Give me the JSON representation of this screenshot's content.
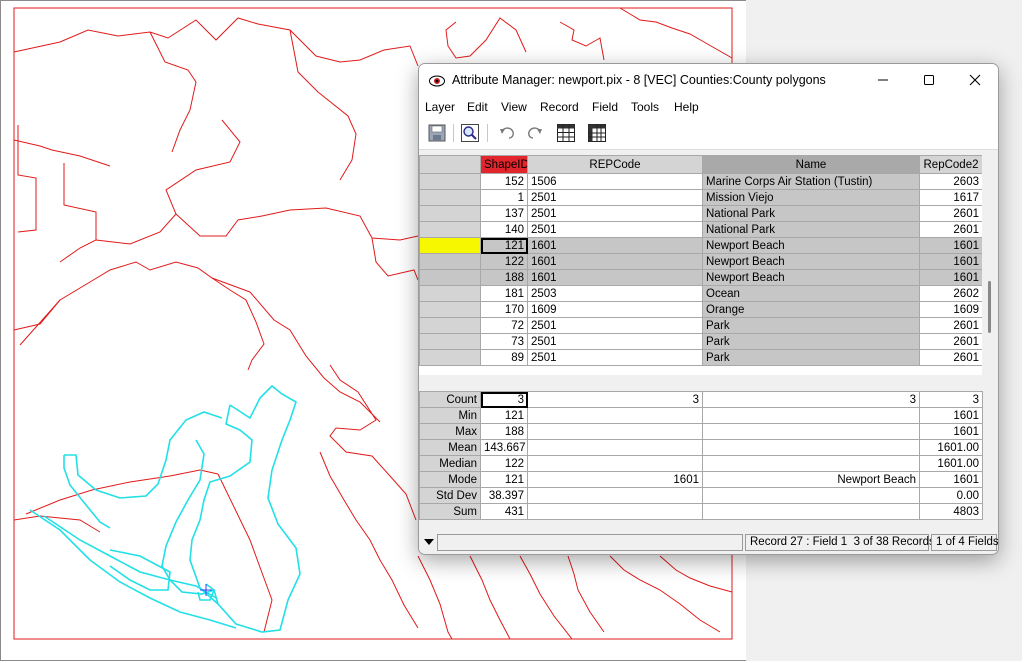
{
  "window": {
    "title": "Attribute Manager: newport.pix - 8 [VEC] Counties:County polygons",
    "minimize_icon": "minimize-icon",
    "maximize_icon": "maximize-icon",
    "close_icon": "close-icon"
  },
  "menu": [
    "Layer",
    "Edit",
    "View",
    "Record",
    "Field",
    "Tools",
    "Help"
  ],
  "toolbar": [
    "save-icon",
    "zoom-to-record-icon",
    "undo-icon",
    "redo-icon",
    "table-icon",
    "grid-table-icon"
  ],
  "table": {
    "columns": [
      "ShapeID",
      "REPCode",
      "Name",
      "RepCode2"
    ],
    "rows": [
      {
        "shapeid": "152",
        "repcode": "1506",
        "name": "Marine Corps Air Station (Tustin)",
        "repcode2": "2603",
        "selected": false
      },
      {
        "shapeid": "1",
        "repcode": "2501",
        "name": "Mission Viejo",
        "repcode2": "1617",
        "selected": false
      },
      {
        "shapeid": "137",
        "repcode": "2501",
        "name": "National Park",
        "repcode2": "2601",
        "selected": false
      },
      {
        "shapeid": "140",
        "repcode": "2501",
        "name": "National Park",
        "repcode2": "2601",
        "selected": false
      },
      {
        "shapeid": "121",
        "repcode": "1601",
        "name": "Newport Beach",
        "repcode2": "1601",
        "selected": true
      },
      {
        "shapeid": "122",
        "repcode": "1601",
        "name": "Newport Beach",
        "repcode2": "1601",
        "selected": true
      },
      {
        "shapeid": "188",
        "repcode": "1601",
        "name": "Newport Beach",
        "repcode2": "1601",
        "selected": true
      },
      {
        "shapeid": "181",
        "repcode": "2503",
        "name": "Ocean",
        "repcode2": "2602",
        "selected": false
      },
      {
        "shapeid": "170",
        "repcode": "1609",
        "name": "Orange",
        "repcode2": "1609",
        "selected": false
      },
      {
        "shapeid": "72",
        "repcode": "2501",
        "name": "Park",
        "repcode2": "2601",
        "selected": false
      },
      {
        "shapeid": "73",
        "repcode": "2501",
        "name": "Park",
        "repcode2": "2601",
        "selected": false
      },
      {
        "shapeid": "89",
        "repcode": "2501",
        "name": "Park",
        "repcode2": "2601",
        "selected": false
      }
    ]
  },
  "stats": [
    {
      "label": "Count",
      "shapeid": "3",
      "repcode": "3",
      "name": "3",
      "repcode2": "3"
    },
    {
      "label": "Min",
      "shapeid": "121",
      "repcode": "",
      "name": "",
      "repcode2": "1601"
    },
    {
      "label": "Max",
      "shapeid": "188",
      "repcode": "",
      "name": "",
      "repcode2": "1601"
    },
    {
      "label": "Mean",
      "shapeid": "143.667",
      "repcode": "",
      "name": "",
      "repcode2": "1601.00"
    },
    {
      "label": "Median",
      "shapeid": "122",
      "repcode": "",
      "name": "",
      "repcode2": "1601.00"
    },
    {
      "label": "Mode",
      "shapeid": "121",
      "repcode": "1601",
      "name": "Newport Beach",
      "repcode2": "1601"
    },
    {
      "label": "Std Dev",
      "shapeid": "38.397",
      "repcode": "",
      "name": "",
      "repcode2": "0.00"
    },
    {
      "label": "Sum",
      "shapeid": "431",
      "repcode": "",
      "name": "",
      "repcode2": "4803"
    }
  ],
  "status": {
    "record": "Record 27 : Field 1",
    "records": "3 of 38 Records",
    "fields": "1 of 4 Fields"
  },
  "colors": {
    "boundary": "#e11a1a",
    "selected_polygon": "#22e0e6",
    "sort_column": "#e3262e",
    "current_row": "#f7f700"
  }
}
